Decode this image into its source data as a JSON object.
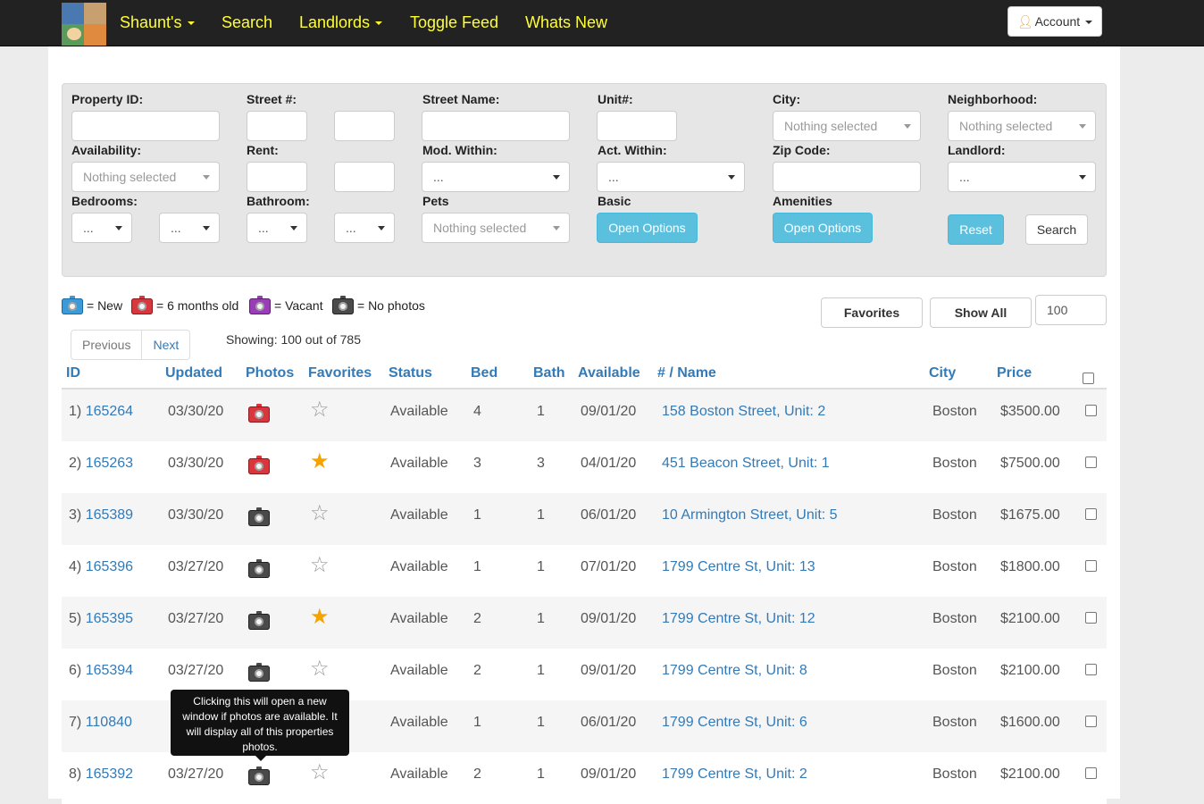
{
  "navbar": {
    "items": [
      {
        "label": "Shaunt's",
        "dropdown": true
      },
      {
        "label": "Search",
        "dropdown": false
      },
      {
        "label": "Landlords",
        "dropdown": true
      },
      {
        "label": "Toggle Feed",
        "dropdown": false
      },
      {
        "label": "Whats New",
        "dropdown": false
      }
    ],
    "account_label": "Account",
    "link_color": "#ffff33"
  },
  "filters": {
    "labels": {
      "property_id": "Property ID:",
      "street_num": "Street #:",
      "street_name": "Street Name:",
      "unit": "Unit#:",
      "city": "City:",
      "neighborhood": "Neighborhood:",
      "availability": "Availability:",
      "rent": "Rent:",
      "mod_within": "Mod. Within:",
      "act_within": "Act. Within:",
      "zip_code": "Zip Code:",
      "landlord": "Landlord:",
      "bedrooms": "Bedrooms:",
      "bathroom": "Bathroom:",
      "pets": "Pets",
      "basic": "Basic",
      "amenities": "Amenities"
    },
    "values": {
      "city": "Nothing selected",
      "neighborhood": "Nothing selected",
      "availability": "Nothing selected",
      "mod_within": "...",
      "act_within": "...",
      "landlord": "...",
      "bed_min": "...",
      "bed_max": "...",
      "bath_min": "...",
      "bath_max": "...",
      "pets": "Nothing selected"
    },
    "buttons": {
      "basic_open": "Open Options",
      "amenities_open": "Open Options",
      "reset": "Reset",
      "search": "Search"
    }
  },
  "legend": {
    "new": "= New",
    "six_months": "= 6 months old",
    "vacant": "= Vacant",
    "no_photos": "= No photos"
  },
  "toolbar": {
    "favorites": "Favorites",
    "show_all": "Show All",
    "per_page": "100"
  },
  "pager": {
    "previous": "Previous",
    "next": "Next",
    "showing": "Showing: 100 out of 785"
  },
  "table": {
    "headers": {
      "id": "ID",
      "updated": "Updated",
      "photos": "Photos",
      "favorites": "Favorites",
      "status": "Status",
      "bed": "Bed",
      "bath": "Bath",
      "available": "Available",
      "name": "# / Name",
      "city": "City",
      "price": "Price"
    },
    "rows": [
      {
        "num": "1)",
        "id": "165264",
        "updated": "03/30/20",
        "photo": "red",
        "fav": false,
        "status": "Available",
        "bed": "4",
        "bath": "1",
        "available": "09/01/20",
        "name": "158 Boston Street, Unit: 2",
        "city": "Boston",
        "price": "$3500.00"
      },
      {
        "num": "2)",
        "id": "165263",
        "updated": "03/30/20",
        "photo": "red",
        "fav": true,
        "status": "Available",
        "bed": "3",
        "bath": "3",
        "available": "04/01/20",
        "name": "451 Beacon Street, Unit: 1",
        "city": "Boston",
        "price": "$7500.00"
      },
      {
        "num": "3)",
        "id": "165389",
        "updated": "03/30/20",
        "photo": "gray",
        "fav": false,
        "status": "Available",
        "bed": "1",
        "bath": "1",
        "available": "06/01/20",
        "name": "10 Armington Street, Unit: 5",
        "city": "Boston",
        "price": "$1675.00"
      },
      {
        "num": "4)",
        "id": "165396",
        "updated": "03/27/20",
        "photo": "gray",
        "fav": false,
        "status": "Available",
        "bed": "1",
        "bath": "1",
        "available": "07/01/20",
        "name": "1799 Centre St, Unit: 13",
        "city": "Boston",
        "price": "$1800.00"
      },
      {
        "num": "5)",
        "id": "165395",
        "updated": "03/27/20",
        "photo": "gray",
        "fav": true,
        "status": "Available",
        "bed": "2",
        "bath": "1",
        "available": "09/01/20",
        "name": "1799 Centre St, Unit: 12",
        "city": "Boston",
        "price": "$2100.00"
      },
      {
        "num": "6)",
        "id": "165394",
        "updated": "03/27/20",
        "photo": "gray",
        "fav": false,
        "status": "Available",
        "bed": "2",
        "bath": "1",
        "available": "09/01/20",
        "name": "1799 Centre St, Unit: 8",
        "city": "Boston",
        "price": "$2100.00"
      },
      {
        "num": "7)",
        "id": "110840",
        "updated": "",
        "photo": "none",
        "fav": null,
        "status": "Available",
        "bed": "1",
        "bath": "1",
        "available": "06/01/20",
        "name": "1799 Centre St, Unit: 6",
        "city": "Boston",
        "price": "$1600.00"
      },
      {
        "num": "8)",
        "id": "165392",
        "updated": "03/27/20",
        "photo": "gray",
        "fav": false,
        "status": "Available",
        "bed": "2",
        "bath": "1",
        "available": "09/01/20",
        "name": "1799 Centre St, Unit: 2",
        "city": "Boston",
        "price": "$2100.00"
      }
    ]
  },
  "tooltip": {
    "text": "Clicking this will open a new window if photos are available. It will display all of this properties photos."
  }
}
